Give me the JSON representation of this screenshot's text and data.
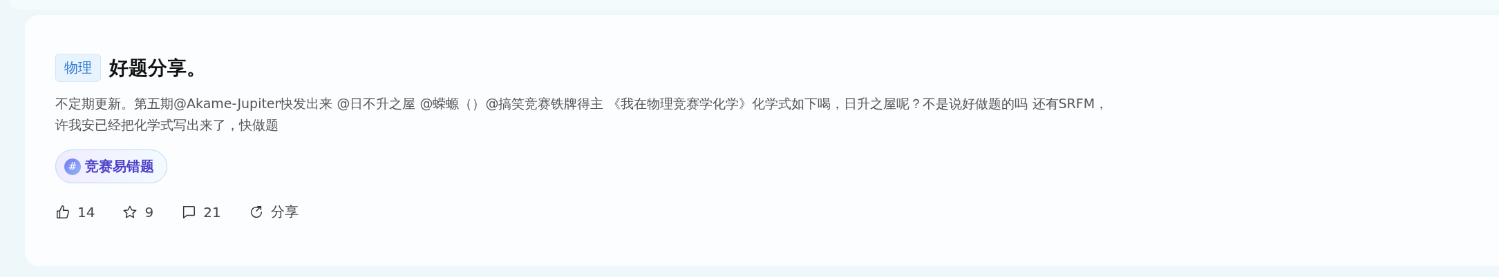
{
  "post": {
    "category": "物理",
    "title": "好题分享。",
    "body_lines": [
      "不定期更新。第五期@Akame-Jupiter快发出来 @日不升之屋  @蝾螈（）@搞笑竞赛铁牌得主 《我在物理竞赛学化学》化学式如下喝，日升之屋呢？不是说好做题的吗 还有SRFM，",
      "许我安已经把化学式写出来了，快做题"
    ],
    "topic": {
      "symbol": "#",
      "label": "竞赛易错题"
    },
    "stats": [
      {
        "kind": "like",
        "count": "14"
      },
      {
        "kind": "star",
        "count": "9"
      },
      {
        "kind": "comment",
        "count": "21"
      },
      {
        "kind": "share",
        "count": "分享"
      }
    ]
  }
}
